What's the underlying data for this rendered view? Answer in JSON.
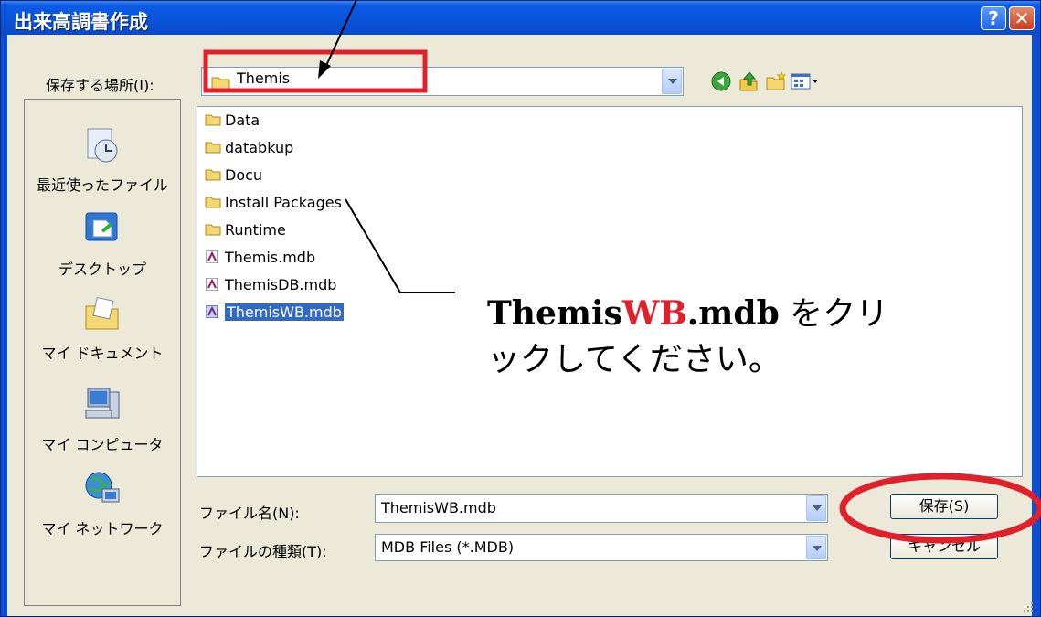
{
  "dialog": {
    "title": "出来高調書作成",
    "help_glyph": "?",
    "close_glyph": "✕"
  },
  "toolbar": {
    "save_in_label": "保存する場所(I):",
    "location_value": "Themis",
    "icons": [
      "back-icon",
      "up-folder-icon",
      "new-folder-icon",
      "views-menu-icon"
    ]
  },
  "places": [
    {
      "label": "最近使ったファイル",
      "icon": "recent-documents-icon"
    },
    {
      "label": "デスクトップ",
      "icon": "desktop-icon"
    },
    {
      "label": "マイ ドキュメント",
      "icon": "my-documents-icon"
    },
    {
      "label": "マイ コンピュータ",
      "icon": "my-computer-icon"
    },
    {
      "label": "マイ ネットワーク",
      "icon": "my-network-icon"
    }
  ],
  "files": [
    {
      "name": "Data",
      "type": "folder"
    },
    {
      "name": "databkup",
      "type": "folder"
    },
    {
      "name": "Docu",
      "type": "folder"
    },
    {
      "name": "Install Packages",
      "type": "folder"
    },
    {
      "name": "Runtime",
      "type": "folder"
    },
    {
      "name": "Themis.mdb",
      "type": "mdb"
    },
    {
      "name": "ThemisDB.mdb",
      "type": "mdb"
    },
    {
      "name": "ThemisWB.mdb",
      "type": "mdb",
      "selected": true
    }
  ],
  "form": {
    "filename_label": "ファイル名(N):",
    "filename_value": "ThemisWB.mdb",
    "filetype_label": "ファイルの種類(T):",
    "filetype_value": "MDB Files (*.MDB)"
  },
  "buttons": {
    "save": "保存(S)",
    "cancel": "キャンセル"
  },
  "callout": {
    "part1": "Themis",
    "part2": "WB",
    "part3": ".mdb",
    "part4": " をクリックしてください。"
  },
  "colors": {
    "annotation_red": "#e0202a",
    "selection_blue": "#316ac5",
    "titlebar_blue": "#0a53da"
  }
}
